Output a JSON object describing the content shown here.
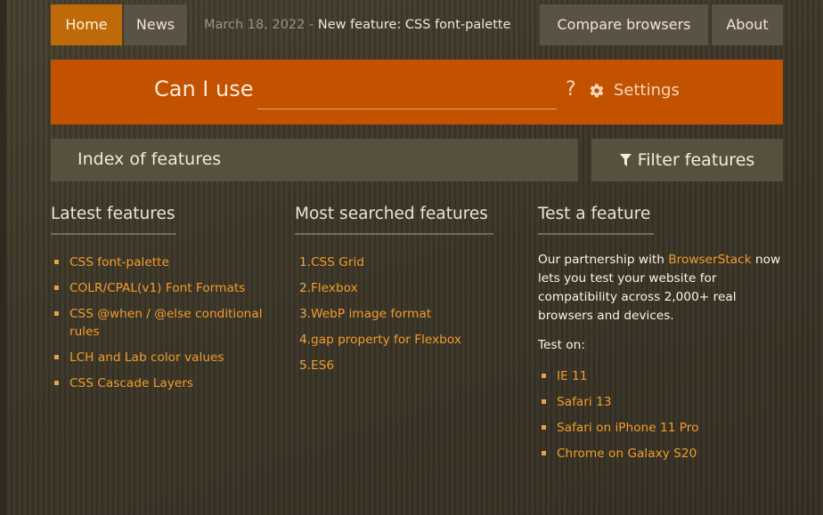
{
  "nav": {
    "home": "Home",
    "news": "News",
    "latest_date": "March 18, 2022",
    "latest_sep": "-",
    "latest_title": "New feature: CSS font-palette",
    "compare": "Compare browsers",
    "about": "About"
  },
  "search": {
    "label": "Can I use",
    "value": "",
    "help": "?",
    "settings_label": "Settings"
  },
  "index": {
    "title": "Index of features",
    "filter_label": "Filter features"
  },
  "latest_features": {
    "title": "Latest features",
    "items": [
      "CSS font-palette",
      "COLR/CPAL(v1) Font Formats",
      "CSS @when / @else conditional rules",
      "LCH and Lab color values",
      "CSS Cascade Layers"
    ]
  },
  "most_searched": {
    "title": "Most searched features",
    "items": [
      {
        "num": "1.",
        "label": "CSS Grid"
      },
      {
        "num": "2.",
        "label": "Flexbox"
      },
      {
        "num": "3.",
        "label": "WebP image format"
      },
      {
        "num": "4.",
        "label": "gap property for Flexbox"
      },
      {
        "num": "5.",
        "label": "ES6"
      }
    ]
  },
  "test_feature": {
    "title": "Test a feature",
    "desc_before": "Our partnership with ",
    "desc_link": "BrowserStack",
    "desc_after": " now lets you test your website for compatibility across 2,000+ real browsers and devices.",
    "test_on": "Test on:",
    "items": [
      "IE 11",
      "Safari 13",
      "Safari on iPhone 11 Pro",
      "Chrome on Galaxy S20"
    ]
  },
  "colors": {
    "accent_orange": "#c25200",
    "home_tab": "#bf6a08",
    "link": "#f19b2c",
    "panel": "#57503f",
    "background": "#3d3728"
  },
  "icons": {
    "settings": "gear-icon",
    "filter": "filter-icon"
  }
}
